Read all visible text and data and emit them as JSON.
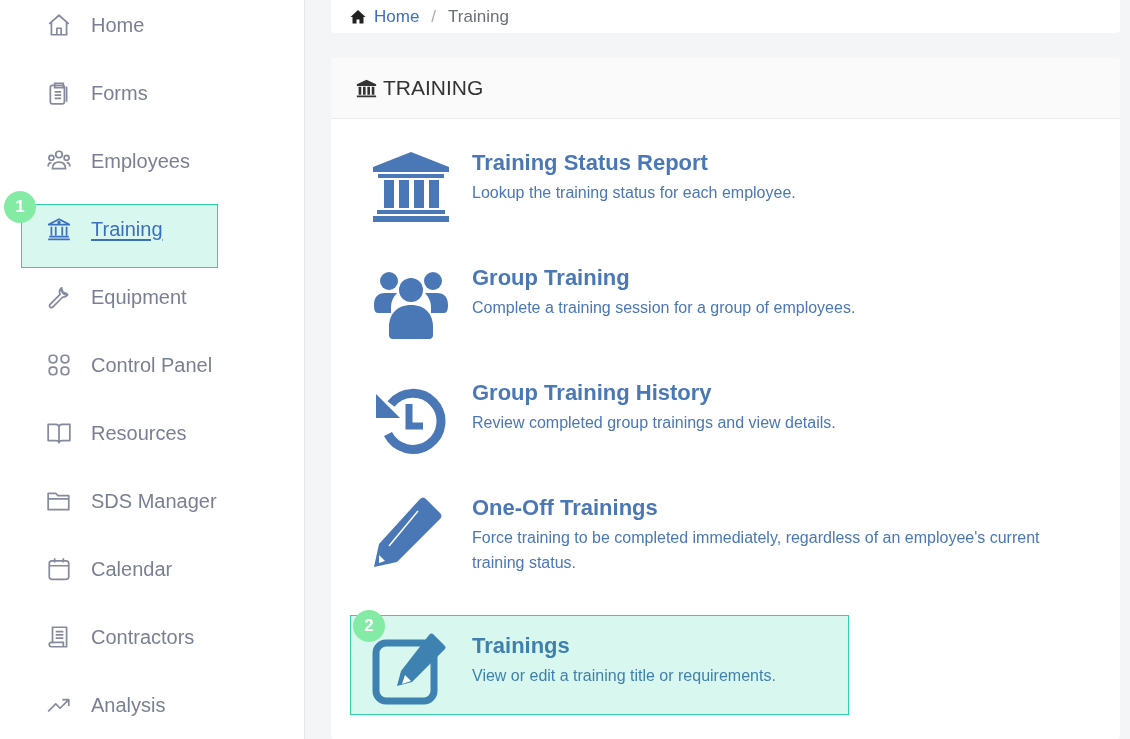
{
  "sidebar": {
    "items": [
      {
        "label": "Home",
        "selected": false
      },
      {
        "label": "Forms",
        "selected": false
      },
      {
        "label": "Employees",
        "selected": false
      },
      {
        "label": "Training",
        "selected": true,
        "step_badge": "1"
      },
      {
        "label": "Equipment",
        "selected": false
      },
      {
        "label": "Control Panel",
        "selected": false
      },
      {
        "label": "Resources",
        "selected": false
      },
      {
        "label": "SDS Manager",
        "selected": false
      },
      {
        "label": "Calendar",
        "selected": false
      },
      {
        "label": "Contractors",
        "selected": false
      },
      {
        "label": "Analysis",
        "selected": false
      }
    ]
  },
  "breadcrumb": {
    "links": [
      "Home"
    ],
    "separator": "/",
    "current": "Training"
  },
  "panel": {
    "title": "TRAINING",
    "items": [
      {
        "title": "Training Status Report",
        "description": "Lookup the training status for each employee."
      },
      {
        "title": "Group Training",
        "description": "Complete a training session for a group of employees."
      },
      {
        "title": "Group Training History",
        "description": "Review completed group trainings and view details."
      },
      {
        "title": "One-Off Trainings",
        "description": "Force training to be completed immediately, regardless of an employee's current training status."
      },
      {
        "title": "Trainings",
        "description": "View or edit a training title or requirements.",
        "step_badge": "2"
      }
    ]
  }
}
